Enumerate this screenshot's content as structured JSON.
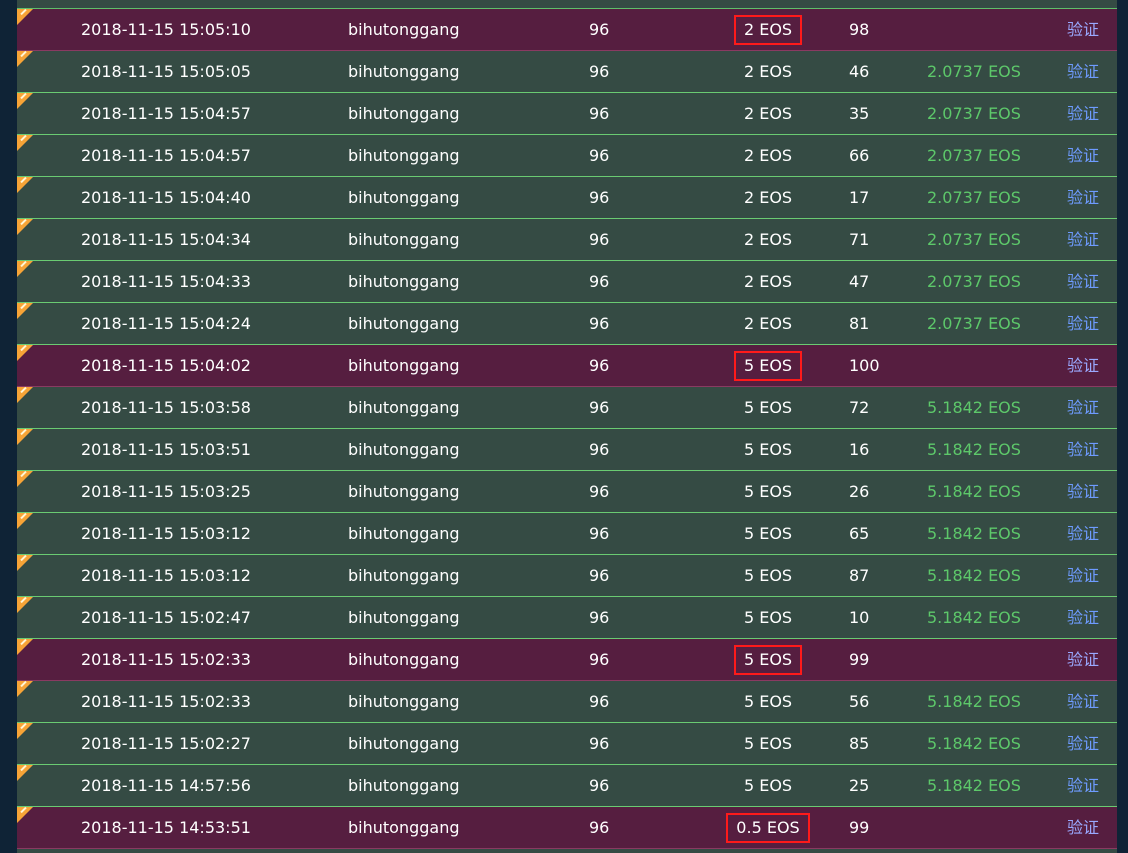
{
  "verify_label": "验证",
  "rows": [
    {
      "time": "2018-11-15 15:05:10",
      "user": "bihutonggang",
      "target": "96",
      "bet": "2 EOS",
      "roll": "98",
      "payout": "",
      "result": "lose"
    },
    {
      "time": "2018-11-15 15:05:05",
      "user": "bihutonggang",
      "target": "96",
      "bet": "2 EOS",
      "roll": "46",
      "payout": "2.0737 EOS",
      "result": "win"
    },
    {
      "time": "2018-11-15 15:04:57",
      "user": "bihutonggang",
      "target": "96",
      "bet": "2 EOS",
      "roll": "35",
      "payout": "2.0737 EOS",
      "result": "win"
    },
    {
      "time": "2018-11-15 15:04:57",
      "user": "bihutonggang",
      "target": "96",
      "bet": "2 EOS",
      "roll": "66",
      "payout": "2.0737 EOS",
      "result": "win"
    },
    {
      "time": "2018-11-15 15:04:40",
      "user": "bihutonggang",
      "target": "96",
      "bet": "2 EOS",
      "roll": "17",
      "payout": "2.0737 EOS",
      "result": "win"
    },
    {
      "time": "2018-11-15 15:04:34",
      "user": "bihutonggang",
      "target": "96",
      "bet": "2 EOS",
      "roll": "71",
      "payout": "2.0737 EOS",
      "result": "win"
    },
    {
      "time": "2018-11-15 15:04:33",
      "user": "bihutonggang",
      "target": "96",
      "bet": "2 EOS",
      "roll": "47",
      "payout": "2.0737 EOS",
      "result": "win"
    },
    {
      "time": "2018-11-15 15:04:24",
      "user": "bihutonggang",
      "target": "96",
      "bet": "2 EOS",
      "roll": "81",
      "payout": "2.0737 EOS",
      "result": "win"
    },
    {
      "time": "2018-11-15 15:04:02",
      "user": "bihutonggang",
      "target": "96",
      "bet": "5 EOS",
      "roll": "100",
      "payout": "",
      "result": "lose"
    },
    {
      "time": "2018-11-15 15:03:58",
      "user": "bihutonggang",
      "target": "96",
      "bet": "5 EOS",
      "roll": "72",
      "payout": "5.1842 EOS",
      "result": "win"
    },
    {
      "time": "2018-11-15 15:03:51",
      "user": "bihutonggang",
      "target": "96",
      "bet": "5 EOS",
      "roll": "16",
      "payout": "5.1842 EOS",
      "result": "win"
    },
    {
      "time": "2018-11-15 15:03:25",
      "user": "bihutonggang",
      "target": "96",
      "bet": "5 EOS",
      "roll": "26",
      "payout": "5.1842 EOS",
      "result": "win"
    },
    {
      "time": "2018-11-15 15:03:12",
      "user": "bihutonggang",
      "target": "96",
      "bet": "5 EOS",
      "roll": "65",
      "payout": "5.1842 EOS",
      "result": "win"
    },
    {
      "time": "2018-11-15 15:03:12",
      "user": "bihutonggang",
      "target": "96",
      "bet": "5 EOS",
      "roll": "87",
      "payout": "5.1842 EOS",
      "result": "win"
    },
    {
      "time": "2018-11-15 15:02:47",
      "user": "bihutonggang",
      "target": "96",
      "bet": "5 EOS",
      "roll": "10",
      "payout": "5.1842 EOS",
      "result": "win"
    },
    {
      "time": "2018-11-15 15:02:33",
      "user": "bihutonggang",
      "target": "96",
      "bet": "5 EOS",
      "roll": "99",
      "payout": "",
      "result": "lose"
    },
    {
      "time": "2018-11-15 15:02:33",
      "user": "bihutonggang",
      "target": "96",
      "bet": "5 EOS",
      "roll": "56",
      "payout": "5.1842 EOS",
      "result": "win"
    },
    {
      "time": "2018-11-15 15:02:27",
      "user": "bihutonggang",
      "target": "96",
      "bet": "5 EOS",
      "roll": "85",
      "payout": "5.1842 EOS",
      "result": "win"
    },
    {
      "time": "2018-11-15 14:57:56",
      "user": "bihutonggang",
      "target": "96",
      "bet": "5 EOS",
      "roll": "25",
      "payout": "5.1842 EOS",
      "result": "win"
    },
    {
      "time": "2018-11-15 14:53:51",
      "user": "bihutonggang",
      "target": "96",
      "bet": "0.5 EOS",
      "roll": "99",
      "payout": "",
      "result": "lose"
    }
  ]
}
